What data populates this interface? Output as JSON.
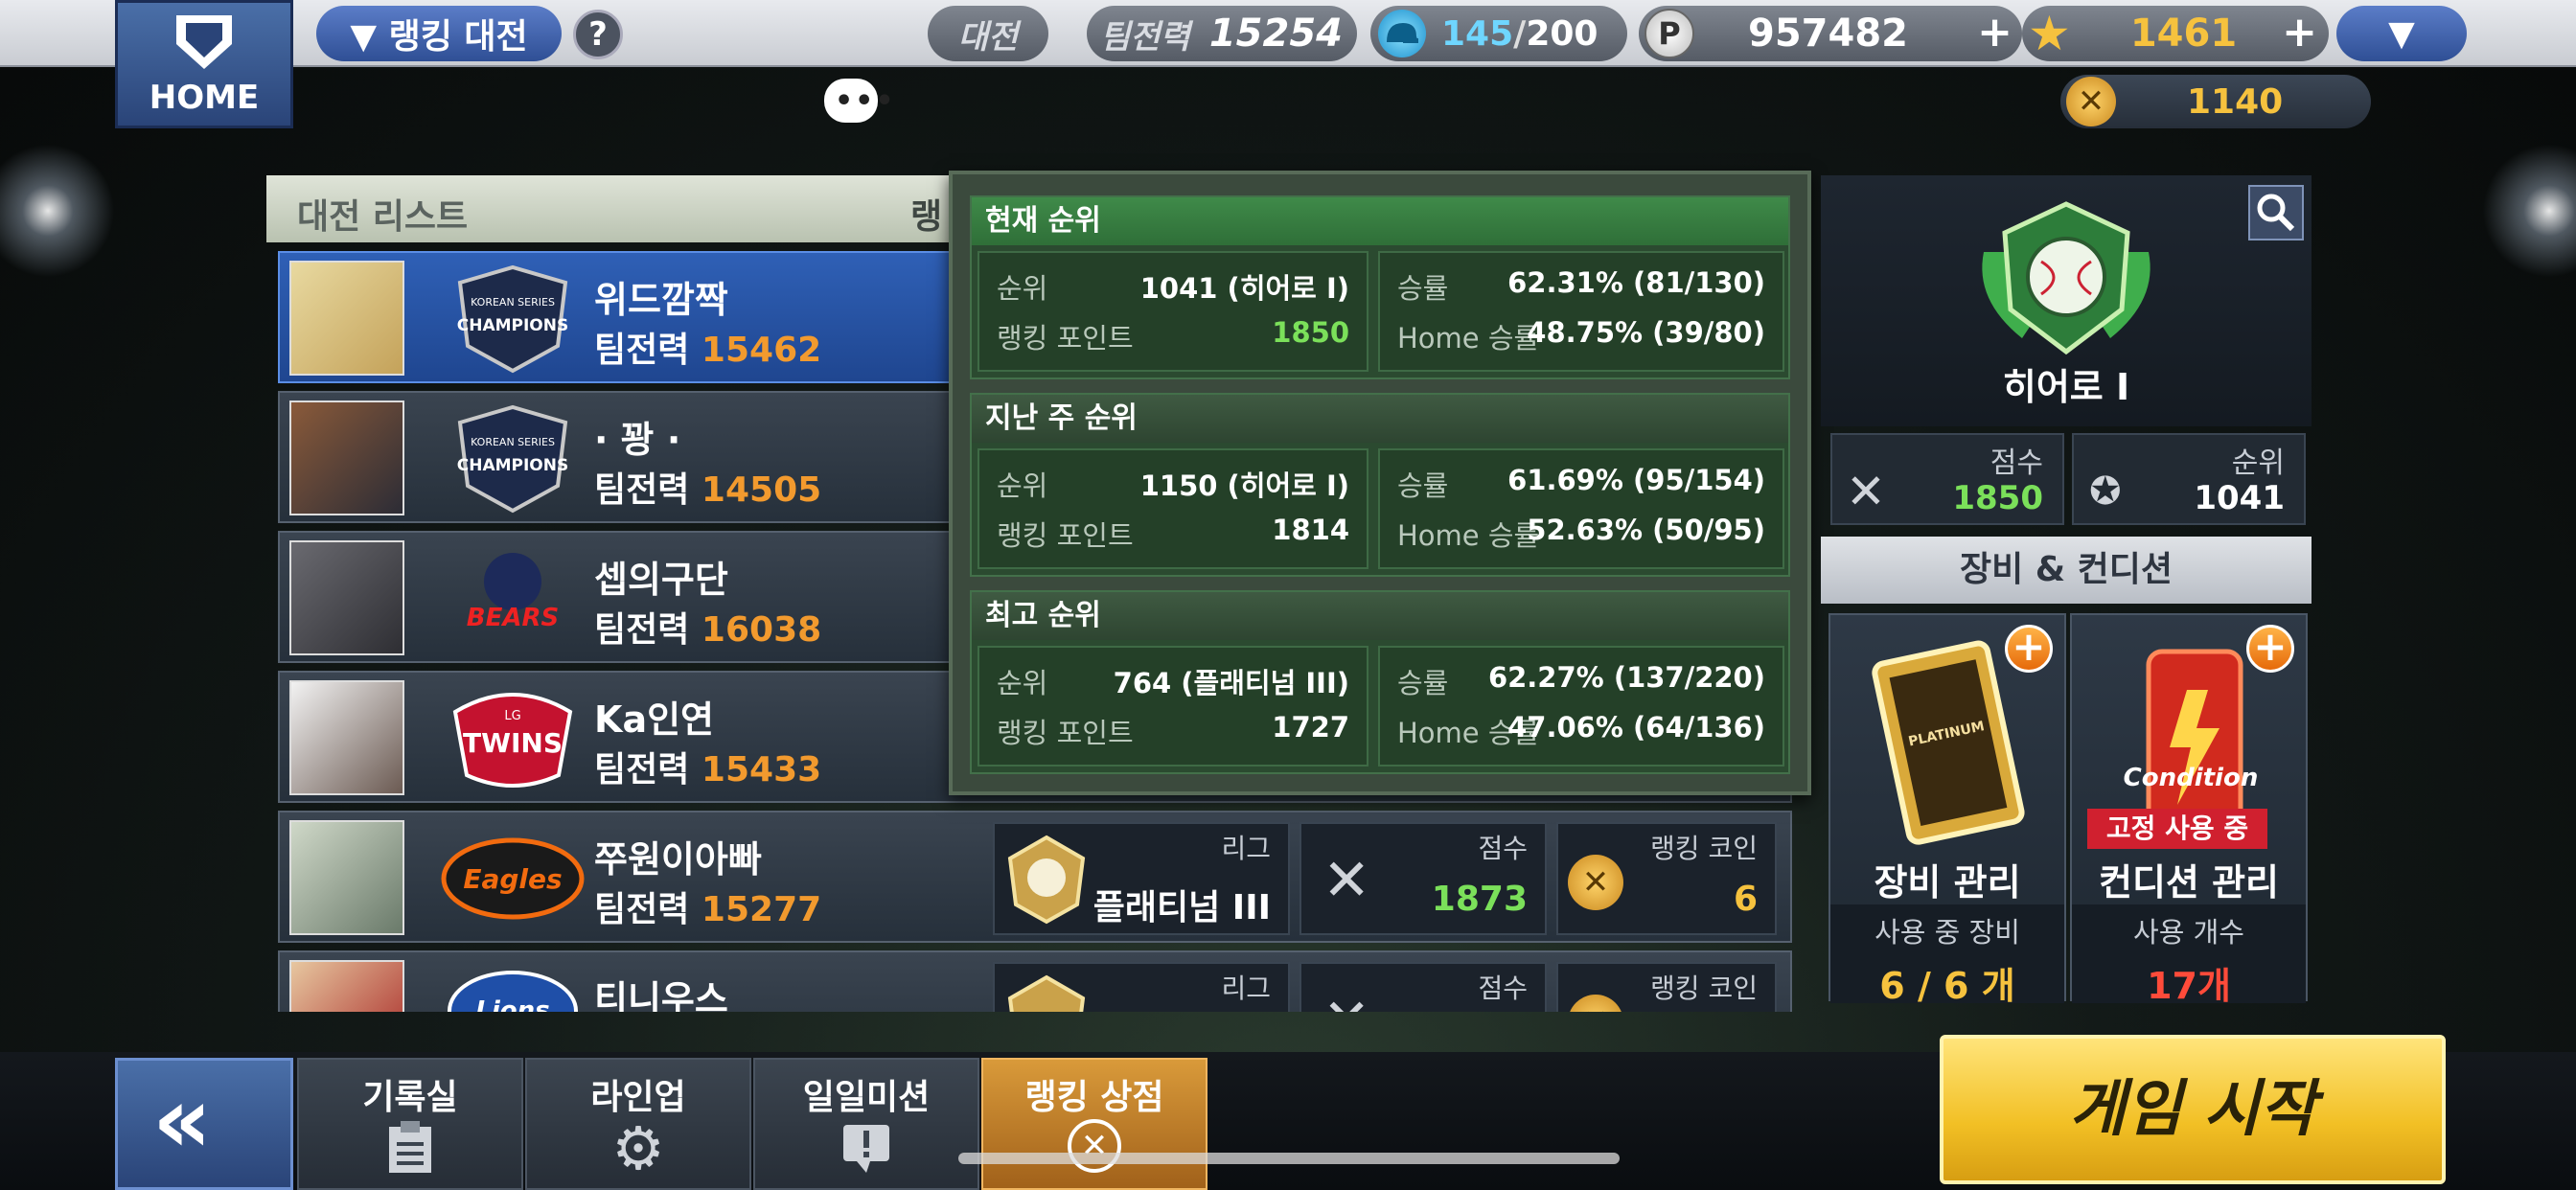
{
  "topbar": {
    "home_label": "HOME",
    "mode_label": "▼ 랭킹 대전",
    "help": "?",
    "battle_label": "대전",
    "team_power_label": "팀전력",
    "team_power_value": "15254",
    "stamina_current": "145",
    "stamina_sep": "/",
    "stamina_max": "200",
    "points_icon": "P",
    "points_value": "957482",
    "stars_value": "1461",
    "plus": "+",
    "menu_arrow": "▼"
  },
  "subbar": {
    "coin_value": "1140"
  },
  "list": {
    "header": "대전 리스트",
    "header_partial": "랭",
    "team_power_label": "팀전력",
    "league_label": "리그",
    "score_label": "점수",
    "coin_label": "랭킹 코인",
    "rows": [
      {
        "name": "위드깜짝",
        "power": "15462",
        "logo": "CHAMPIONS"
      },
      {
        "name": "· 꽝 ·",
        "power": "14505",
        "logo": "CHAMPIONS"
      },
      {
        "name": "셉의구단",
        "power": "16038",
        "logo": "BEARS"
      },
      {
        "name": "Ka인연",
        "power": "15433",
        "logo": "TWINS"
      },
      {
        "name": "쭈원이아빠",
        "power": "15277",
        "logo": "Eagles",
        "league": "플래티넘 III",
        "score": "1873",
        "coins": "6"
      },
      {
        "name": "티니우스",
        "power": "",
        "logo": "Lions",
        "league": "",
        "score": "",
        "coins": ""
      }
    ],
    "logo_texts": {
      "champions_top": "KOREAN SERIES",
      "bears": "BEARS",
      "twins_top": "LG",
      "twins": "TWINS"
    }
  },
  "popup": {
    "sections": [
      {
        "title": "현재 순위",
        "rank_label": "순위",
        "rank": "1041 (히어로 I)",
        "points_label": "랭킹 포인트",
        "points": "1850",
        "win_label": "승률",
        "win": "62.31% (81/130)",
        "home_label": "Home 승률",
        "home": "48.75% (39/80)"
      },
      {
        "title": "지난 주 순위",
        "rank_label": "순위",
        "rank": "1150 (히어로 I)",
        "points_label": "랭킹 포인트",
        "points": "1814",
        "win_label": "승률",
        "win": "61.69% (95/154)",
        "home_label": "Home 승률",
        "home": "52.63% (50/95)"
      },
      {
        "title": "최고 순위",
        "rank_label": "순위",
        "rank": "764 (플래티넘 III)",
        "points_label": "랭킹 포인트",
        "points": "1727",
        "win_label": "승률",
        "win": "62.27% (137/220)",
        "home_label": "Home 승률",
        "home": "47.06% (64/136)"
      }
    ]
  },
  "profile": {
    "tier": "히어로 I",
    "score_label": "점수",
    "score": "1850",
    "rank_label": "순위",
    "rank": "1041",
    "equip_header": "장비 & 컨디션",
    "equip_title": "장비 관리",
    "equip_sub": "사용 중 장비",
    "equip_value": "6 / 6 개",
    "platinum_text": "PLATINUM",
    "cond_title": "컨디션 관리",
    "cond_sub": "사용 개수",
    "cond_value": "17개",
    "cond_badge": "고정 사용 중",
    "cond_art_text": "Condition"
  },
  "bottom": {
    "back": "«",
    "nav": [
      "기록실",
      "라인업",
      "일일미션",
      "랭킹 상점"
    ],
    "start": "게임 시작"
  },
  "colors": {
    "accent_orange": "#f29a2e",
    "score_green": "#7be05a",
    "gold": "#f6c23e",
    "red": "#ff4b3a"
  }
}
